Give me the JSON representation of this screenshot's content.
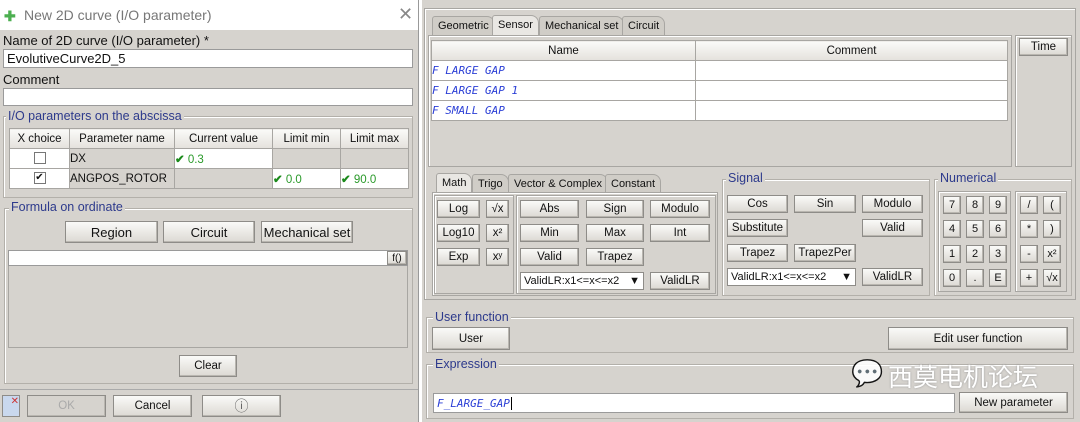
{
  "window": {
    "title": "New 2D curve (I/O parameter)",
    "close": "✕"
  },
  "left": {
    "name_label": "Name of  2D curve (I/O parameter) *",
    "name_value": "EvolutiveCurve2D_5",
    "comment_label": "Comment",
    "comment_value": "",
    "abscissa_legend": "I/O parameters on the abscissa",
    "table": {
      "headers": [
        "X choice",
        "Parameter name",
        "Current value",
        "Limit min",
        "Limit max"
      ],
      "rows": [
        {
          "checked": false,
          "name": "DX",
          "current": "0.3",
          "min": "",
          "max": ""
        },
        {
          "checked": true,
          "name": "ANGPOS_ROTOR",
          "current": "",
          "min": "0.0",
          "max": "90.0"
        }
      ]
    },
    "formula_legend": "Formula on ordinate",
    "buttons": {
      "region": "Region",
      "circuit": "Circuit",
      "mechanical": "Mechanical set",
      "fx": "f()",
      "clear": "Clear"
    },
    "formula_value": "",
    "footer": {
      "ok": "OK",
      "cancel": "Cancel",
      "info": "ⓘ"
    }
  },
  "right": {
    "tabs": [
      "Geometric",
      "Sensor",
      "Mechanical set",
      "Circuit"
    ],
    "active_tab": "Sensor",
    "list": {
      "headers": [
        "Name",
        "Comment"
      ],
      "rows": [
        {
          "name": "F LARGE GAP",
          "comment": ""
        },
        {
          "name": "F LARGE GAP 1",
          "comment": ""
        },
        {
          "name": "F SMALL GAP",
          "comment": ""
        }
      ]
    },
    "time_button": "Time",
    "func_tabs": [
      "Math",
      "Trigo",
      "Vector & Complex",
      "Constant"
    ],
    "math": {
      "log": "Log",
      "log10": "Log10",
      "exp": "Exp",
      "sqrt": "√x",
      "sq": "x²",
      "pow": "xʸ",
      "abs": "Abs",
      "sign": "Sign",
      "modulo": "Modulo",
      "min": "Min",
      "max": "Max",
      "int": "Int",
      "valid": "Valid",
      "trapez": "Trapez",
      "select": "ValidLR:x1<=x<=x2",
      "validlr": "ValidLR"
    },
    "signal": {
      "legend": "Signal",
      "cos": "Cos",
      "sin": "Sin",
      "modulo": "Modulo",
      "substitute": "Substitute",
      "valid": "Valid",
      "trapez": "Trapez",
      "trapezper": "TrapezPer",
      "select": "ValidLR:x1<=x<=x2",
      "validlr": "ValidLR"
    },
    "numerical": {
      "legend": "Numerical",
      "digits": [
        "7",
        "8",
        "9",
        "4",
        "5",
        "6",
        "1",
        "2",
        "3",
        "0",
        ".",
        "E"
      ],
      "ops": [
        "/",
        "(",
        "*",
        ")",
        "-",
        "x²",
        "+",
        "√x"
      ]
    },
    "user": {
      "legend": "User function",
      "user": "User",
      "edit": "Edit user function"
    },
    "expression": {
      "legend": "Expression",
      "value": "F_LARGE_GAP",
      "new_param": "New parameter"
    },
    "watermark": "西莫电机论坛"
  }
}
